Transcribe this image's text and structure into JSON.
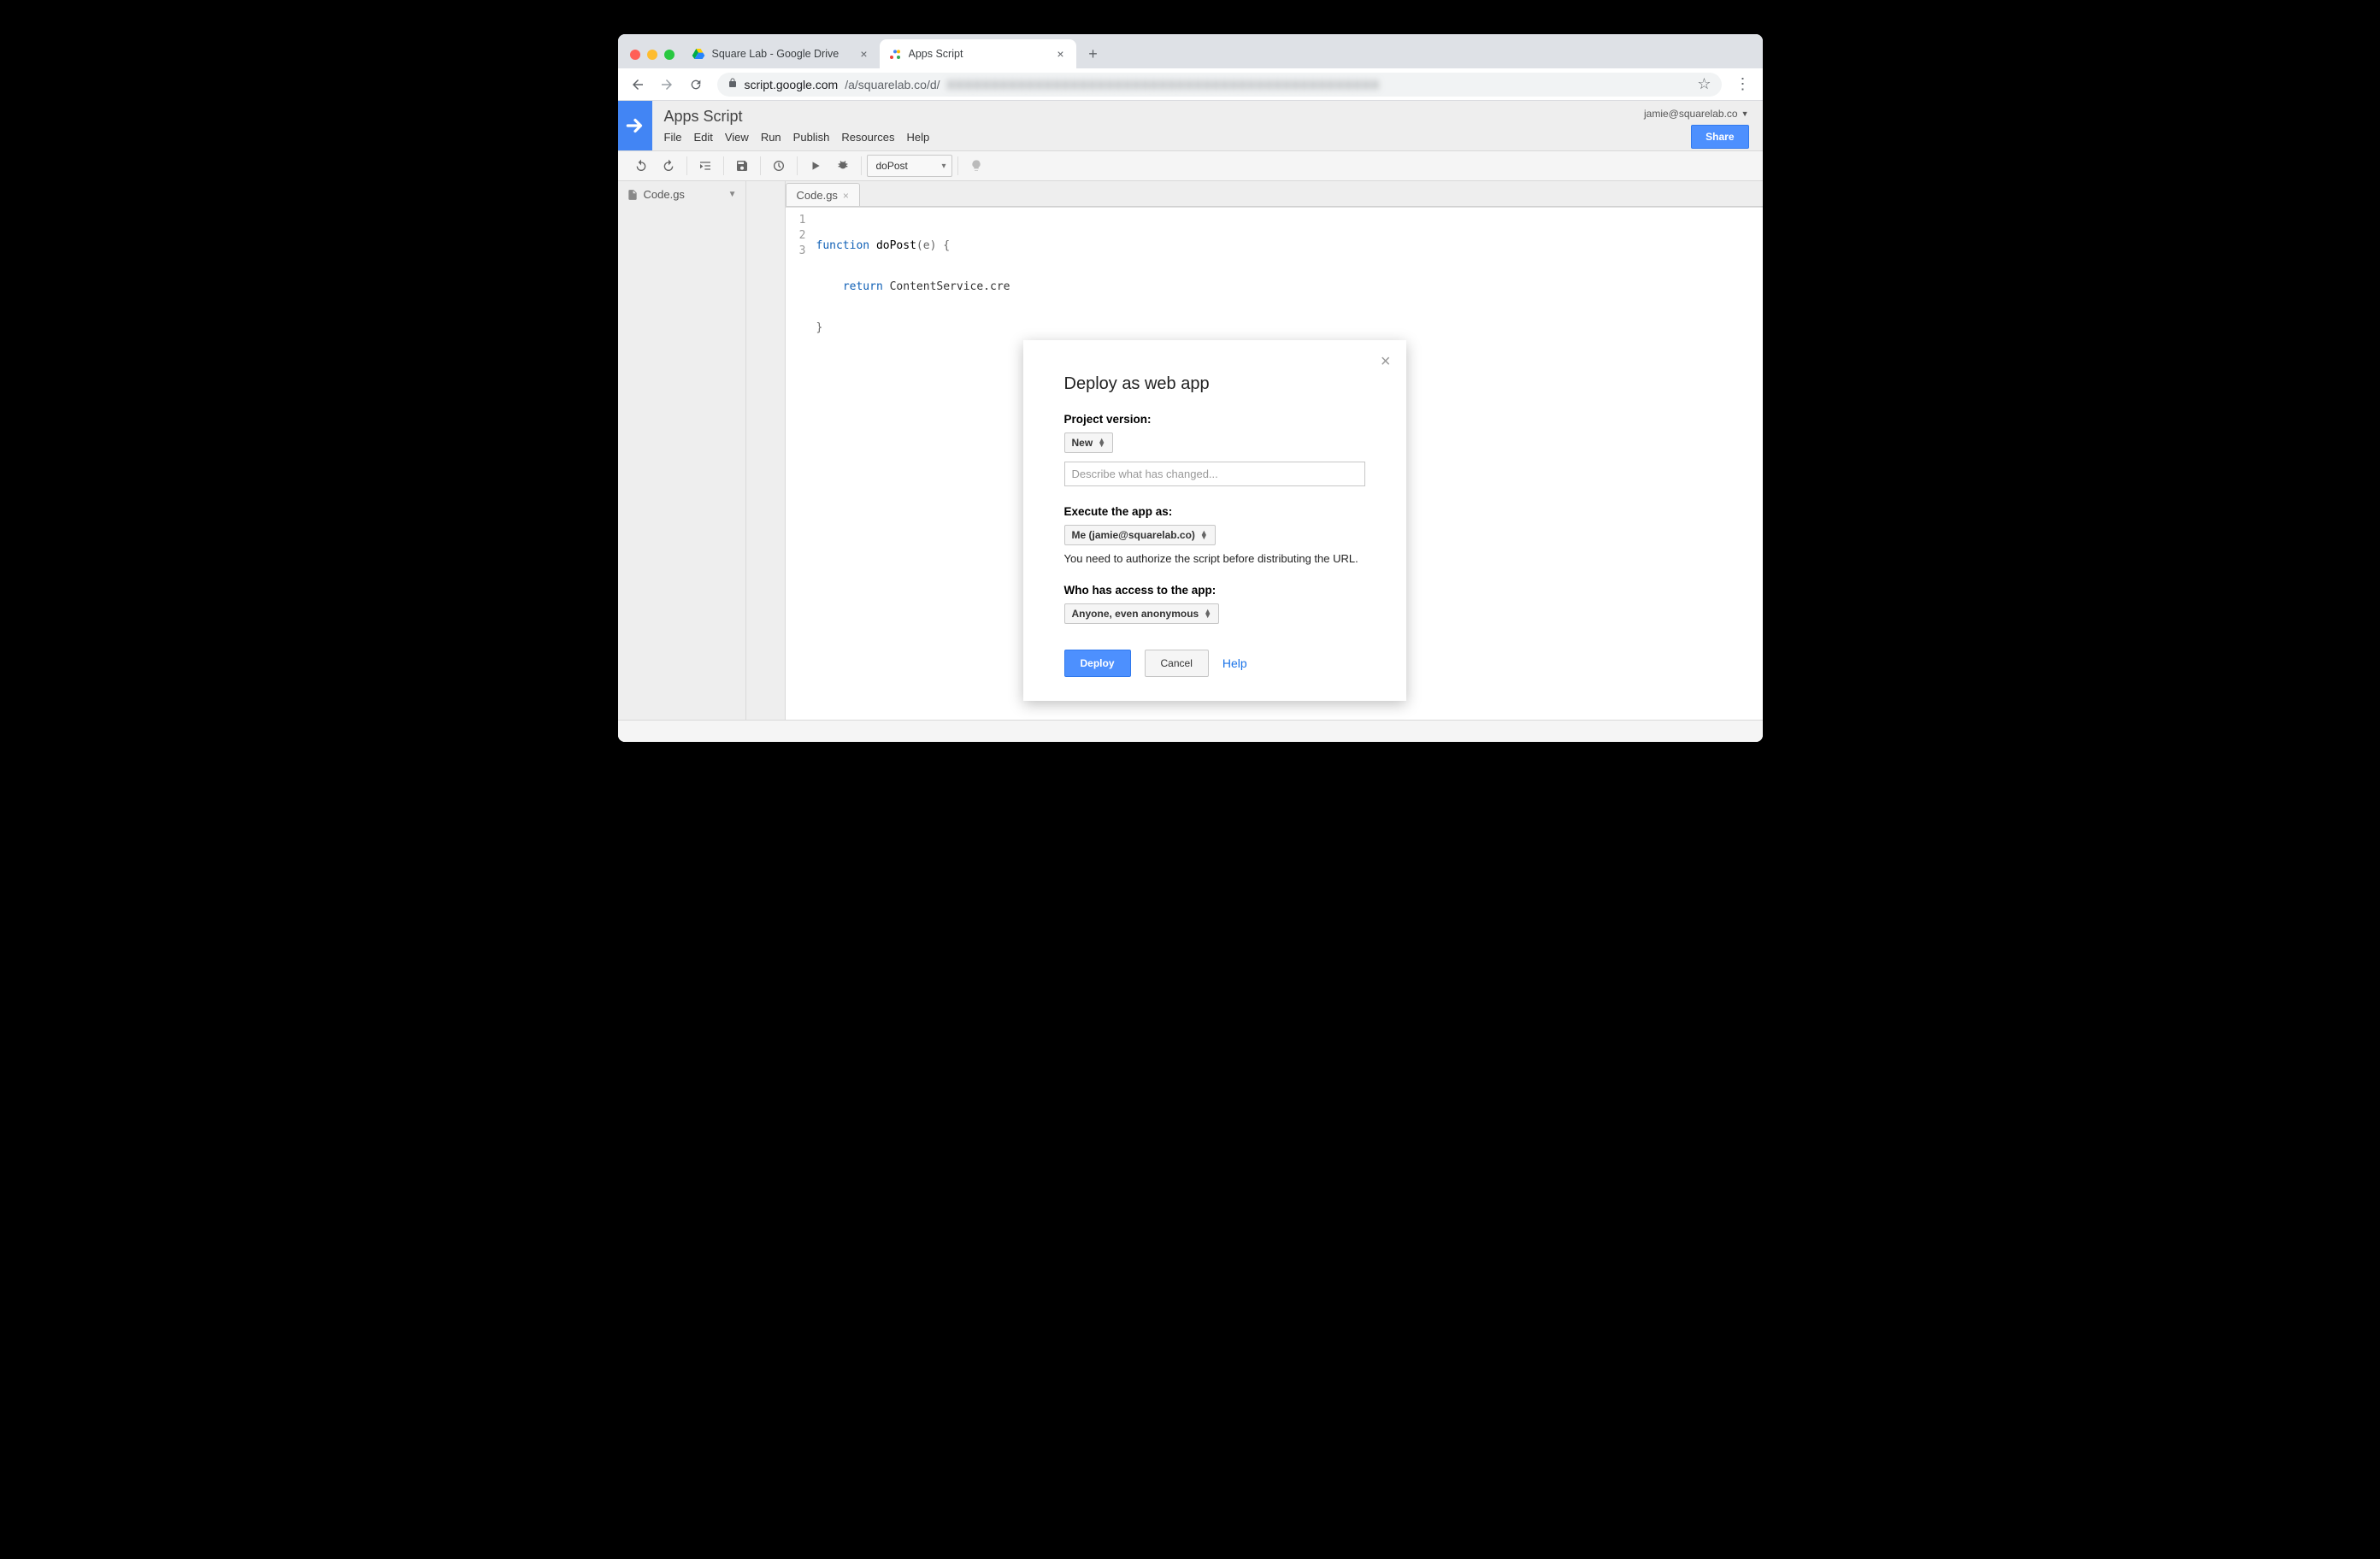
{
  "browser": {
    "tabs": [
      {
        "title": "Square Lab - Google Drive",
        "active": false
      },
      {
        "title": "Apps Script",
        "active": true
      }
    ],
    "url_domain": "script.google.com",
    "url_rest": "/a/squarelab.co/d/"
  },
  "header": {
    "app_title": "Apps Script",
    "menus": [
      "File",
      "Edit",
      "View",
      "Run",
      "Publish",
      "Resources",
      "Help"
    ],
    "user_email": "jamie@squarelab.co",
    "share_label": "Share"
  },
  "toolbar": {
    "function_selected": "doPost"
  },
  "sidebar": {
    "file_name": "Code.gs"
  },
  "editor": {
    "tab_name": "Code.gs",
    "gutter": [
      "1",
      "2",
      "3"
    ],
    "lines": {
      "l1_kw": "function",
      "l1_name": " doPost",
      "l1_rest": "(e) {",
      "l2_indent": "    ",
      "l2_kw": "return",
      "l2_rest": " ContentService.cre",
      "l3": "}"
    }
  },
  "modal": {
    "title": "Deploy as web app",
    "version_label": "Project version:",
    "version_value": "New",
    "description_placeholder": "Describe what has changed...",
    "execute_label": "Execute the app as:",
    "execute_value": "Me (jamie@squarelab.co)",
    "auth_note": "You need to authorize the script before distributing the URL.",
    "access_label": "Who has access to the app:",
    "access_value": "Anyone, even anonymous",
    "deploy_btn": "Deploy",
    "cancel_btn": "Cancel",
    "help_link": "Help"
  }
}
